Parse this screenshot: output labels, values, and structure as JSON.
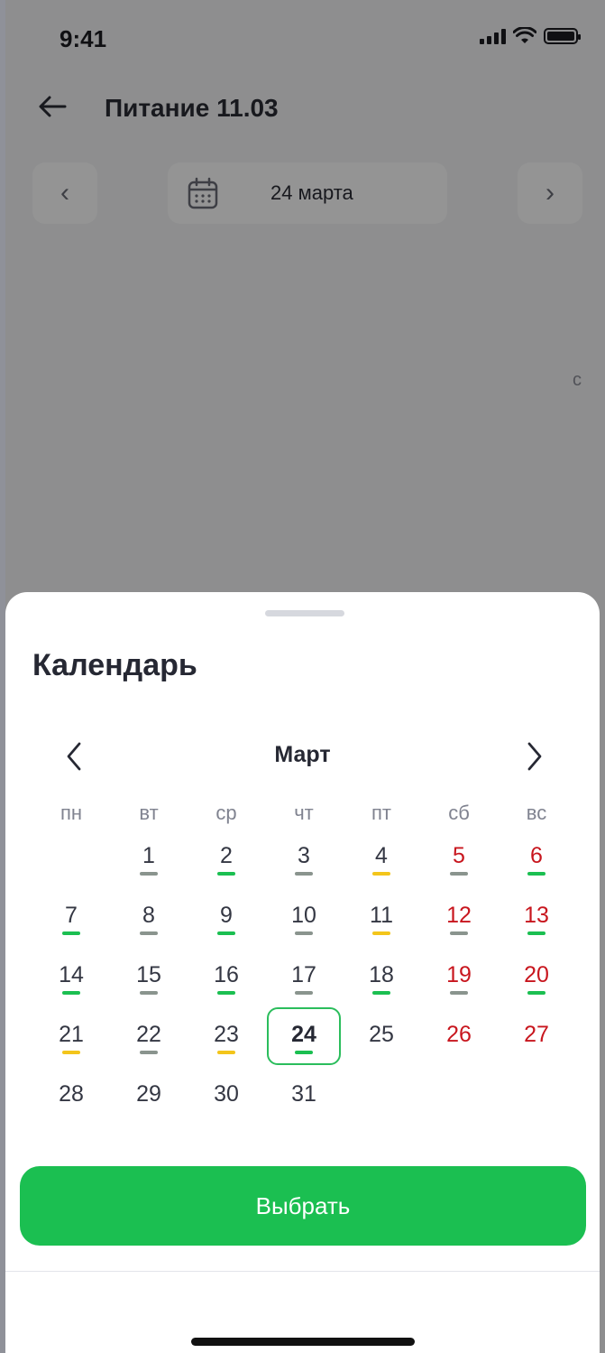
{
  "status_bar": {
    "time": "9:41"
  },
  "header": {
    "title": "Питание 11.03"
  },
  "date_nav": {
    "prev_label": "‹",
    "next_label": "›",
    "date_label": "24 марта"
  },
  "background": {
    "partial_text": "с"
  },
  "sheet": {
    "title": "Календарь",
    "month": "Март",
    "weekdays": [
      "пн",
      "вт",
      "ср",
      "чт",
      "пт",
      "сб",
      "вс"
    ],
    "select_button": "Выбрать"
  },
  "colors": {
    "green": "#1bbf51",
    "yellow": "#f3c51b",
    "gray": "#8a948e",
    "weekend": "#c8161e",
    "selection_border": "#2bbd5c"
  },
  "calendar": {
    "first_weekday_index": 1,
    "selected_day": 24,
    "days": [
      {
        "day": "1",
        "weekend": false,
        "bar": "gray"
      },
      {
        "day": "2",
        "weekend": false,
        "bar": "green"
      },
      {
        "day": "3",
        "weekend": false,
        "bar": "gray"
      },
      {
        "day": "4",
        "weekend": false,
        "bar": "yellow"
      },
      {
        "day": "5",
        "weekend": true,
        "bar": "gray"
      },
      {
        "day": "6",
        "weekend": true,
        "bar": "green"
      },
      {
        "day": "7",
        "weekend": false,
        "bar": "green"
      },
      {
        "day": "8",
        "weekend": false,
        "bar": "gray"
      },
      {
        "day": "9",
        "weekend": false,
        "bar": "green"
      },
      {
        "day": "10",
        "weekend": false,
        "bar": "gray"
      },
      {
        "day": "11",
        "weekend": false,
        "bar": "yellow"
      },
      {
        "day": "12",
        "weekend": true,
        "bar": "gray"
      },
      {
        "day": "13",
        "weekend": true,
        "bar": "green"
      },
      {
        "day": "14",
        "weekend": false,
        "bar": "green"
      },
      {
        "day": "15",
        "weekend": false,
        "bar": "gray"
      },
      {
        "day": "16",
        "weekend": false,
        "bar": "green"
      },
      {
        "day": "17",
        "weekend": false,
        "bar": "gray"
      },
      {
        "day": "18",
        "weekend": false,
        "bar": "green"
      },
      {
        "day": "19",
        "weekend": true,
        "bar": "gray"
      },
      {
        "day": "20",
        "weekend": true,
        "bar": "green"
      },
      {
        "day": "21",
        "weekend": false,
        "bar": "yellow"
      },
      {
        "day": "22",
        "weekend": false,
        "bar": "gray"
      },
      {
        "day": "23",
        "weekend": false,
        "bar": "yellow"
      },
      {
        "day": "24",
        "weekend": false,
        "bar": "green"
      },
      {
        "day": "25",
        "weekend": false,
        "bar": ""
      },
      {
        "day": "26",
        "weekend": true,
        "bar": ""
      },
      {
        "day": "27",
        "weekend": true,
        "bar": ""
      },
      {
        "day": "28",
        "weekend": false,
        "bar": ""
      },
      {
        "day": "29",
        "weekend": false,
        "bar": ""
      },
      {
        "day": "30",
        "weekend": false,
        "bar": ""
      },
      {
        "day": "31",
        "weekend": false,
        "bar": ""
      }
    ]
  }
}
